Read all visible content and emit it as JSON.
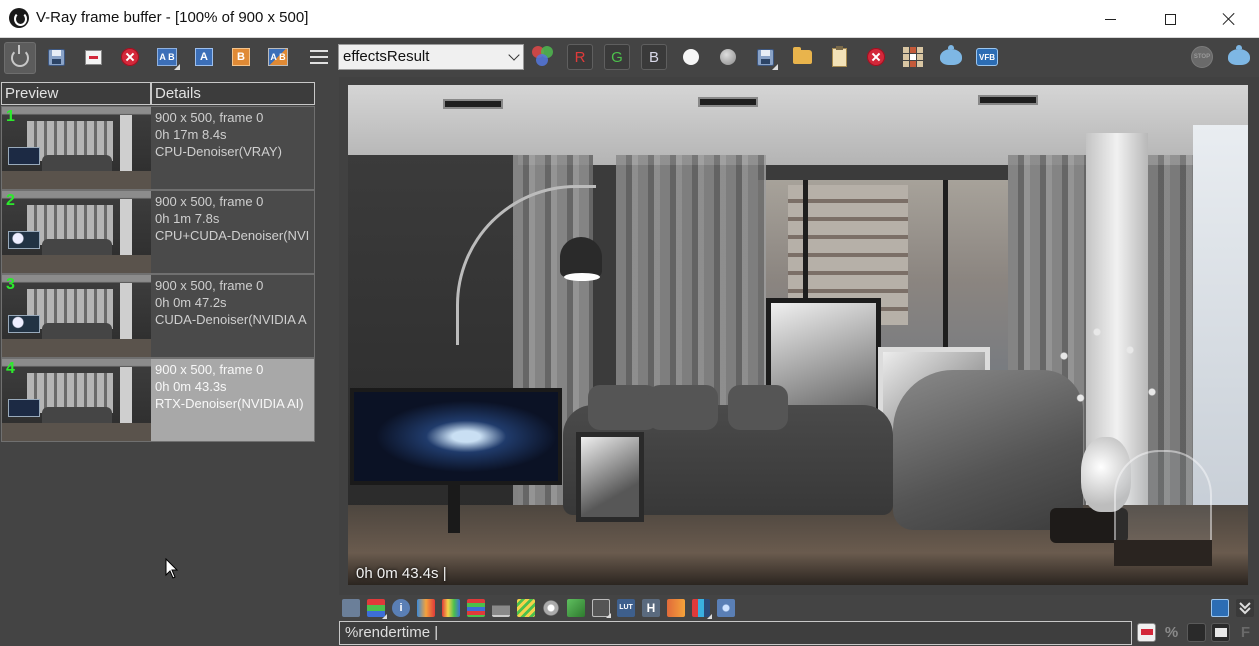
{
  "window": {
    "title": "V-Ray frame buffer - [100% of 900 x 500]",
    "controls": {
      "minimize_icon": "minimize-icon",
      "maximize_icon": "maximize-icon",
      "close_icon": "close-icon"
    }
  },
  "toolbar": {
    "channel": "effectsResult",
    "channel_options": [
      "effectsResult"
    ],
    "channel_buttons": {
      "red": "R",
      "green": "G",
      "blue": "B"
    },
    "ab_compare_label": "A B",
    "a_label": "A",
    "b_label": "B",
    "ab_swap_label": "A B",
    "colors": {
      "red_channel": "#e03a3a",
      "green_channel": "#4cc04c",
      "blue_channel": "#d8d8e8"
    }
  },
  "history": {
    "columns": [
      "Preview",
      "Details"
    ],
    "items": [
      {
        "number": "1",
        "resolution": "900 x 500, frame 0",
        "time": "0h 17m 8.4s",
        "denoiser": "CPU-Denoiser(VRAY)",
        "selected": false
      },
      {
        "number": "2",
        "resolution": "900 x 500, frame 0",
        "time": "0h 1m 7.8s",
        "denoiser": "CPU+CUDA-Denoiser(NVI",
        "selected": false
      },
      {
        "number": "3",
        "resolution": "900 x 500, frame 0",
        "time": "0h 0m 47.2s",
        "denoiser": "CUDA-Denoiser(NVIDIA A",
        "selected": false
      },
      {
        "number": "4",
        "resolution": "900 x 500, frame 0",
        "time": "0h 0m 43.3s",
        "denoiser": "RTX-Denoiser(NVIDIA AI)",
        "selected": true
      }
    ]
  },
  "render": {
    "stamp": "0h  0m 43.4s |"
  },
  "bottom": {
    "expression": "%rendertime |",
    "percent_label": "%",
    "font_label": "F"
  }
}
